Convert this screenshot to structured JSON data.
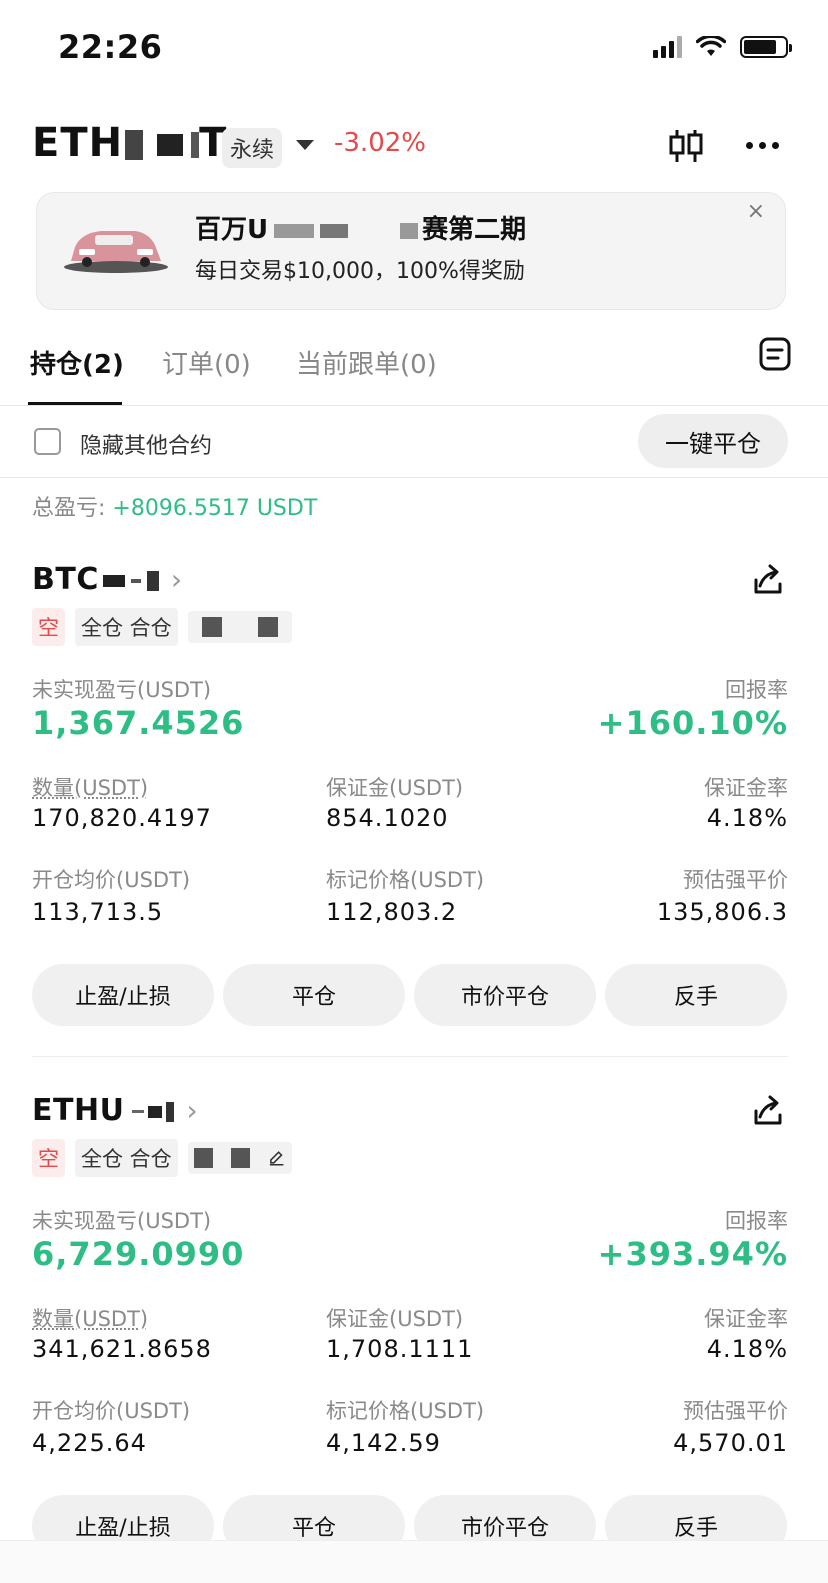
{
  "status": {
    "time": "22:26"
  },
  "header": {
    "pair": "ETH",
    "pair_tail": "T",
    "contract_type": "永续",
    "change": "-3.02%",
    "icons": [
      "candlestick-icon",
      "more-icon"
    ]
  },
  "banner": {
    "title_left": "百万U",
    "title_right": "赛第二期",
    "subtitle": "每日交易$10,000，100%得奖励",
    "close": "×"
  },
  "tabs": [
    {
      "label": "持仓(2)",
      "active": true
    },
    {
      "label": "订单(0)",
      "active": false
    },
    {
      "label": "当前跟单(0)",
      "active": false
    }
  ],
  "filter": {
    "hide_label": "隐藏其他合约",
    "close_all": "一键平仓"
  },
  "summary": {
    "label": "总盈亏:",
    "value": "+8096.5517 USDT"
  },
  "positions": [
    {
      "symbol": "BTC",
      "side": "空",
      "mode": "全仓 合仓",
      "pnl_label": "未实现盈亏(USDT)",
      "pnl": "1,367.4526",
      "roe_label": "回报率",
      "roe": "+160.10%",
      "qty_label": "数量(USDT)",
      "qty": "170,820.4197",
      "margin_label": "保证金(USDT)",
      "margin": "854.1020",
      "margin_ratio_label": "保证金率",
      "margin_ratio": "4.18%",
      "entry_label": "开仓均价(USDT)",
      "entry": "113,713.5",
      "mark_label": "标记价格(USDT)",
      "mark": "112,803.2",
      "liq_label": "预估强平价",
      "liq": "135,806.3",
      "buttons": [
        "止盈/止损",
        "平仓",
        "市价平仓",
        "反手"
      ]
    },
    {
      "symbol": "ETHU",
      "side": "空",
      "mode": "全仓 合仓",
      "pnl_label": "未实现盈亏(USDT)",
      "pnl": "6,729.0990",
      "roe_label": "回报率",
      "roe": "+393.94%",
      "qty_label": "数量(USDT)",
      "qty": "341,621.8658",
      "margin_label": "保证金(USDT)",
      "margin": "1,708.1111",
      "margin_ratio_label": "保证金率",
      "margin_ratio": "4.18%",
      "entry_label": "开仓均价(USDT)",
      "entry": "4,225.64",
      "mark_label": "标记价格(USDT)",
      "mark": "4,142.59",
      "liq_label": "预估强平价",
      "liq": "4,570.01",
      "buttons": [
        "止盈/止损",
        "平仓",
        "市价平仓",
        "反手"
      ]
    }
  ],
  "colors": {
    "profit": "#2ebd85",
    "loss": "#e34a4a"
  }
}
